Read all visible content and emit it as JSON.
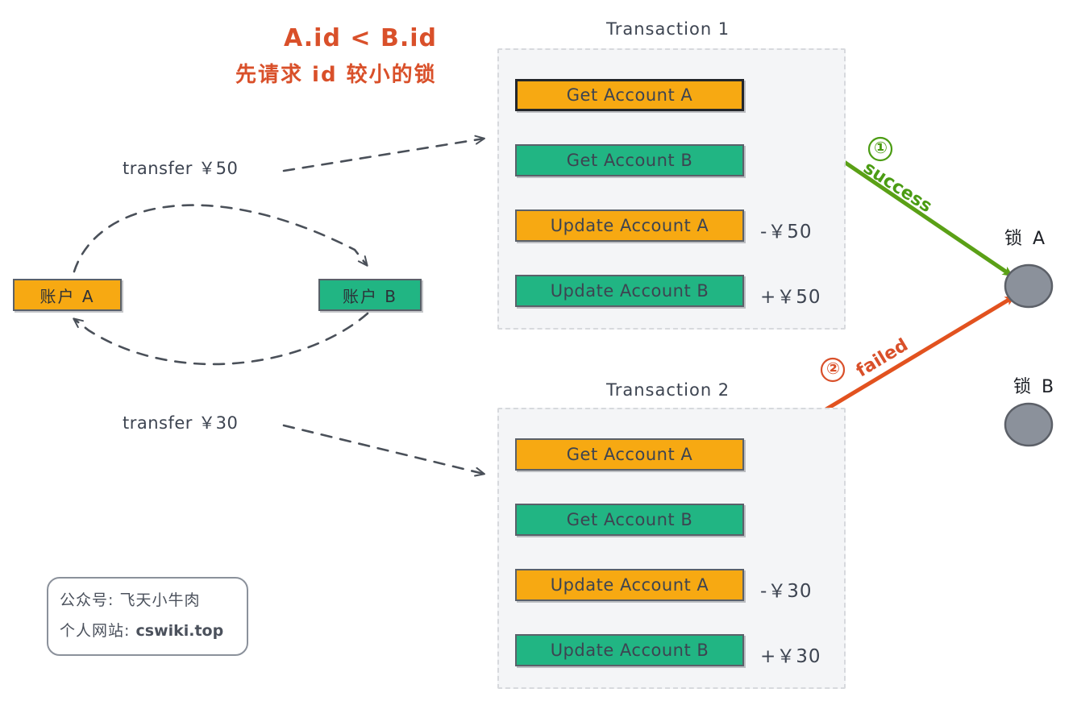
{
  "headline": {
    "line1": "A.id < B.id",
    "line2": "先请求 id 较小的锁",
    "color": "#d9502a"
  },
  "accounts": [
    {
      "label": "账户 A",
      "color": "#f7a912"
    },
    {
      "label": "账户 B",
      "color": "#21b583"
    }
  ],
  "transfers": [
    {
      "label": "transfer ￥50"
    },
    {
      "label": "transfer ￥30"
    }
  ],
  "transactions": [
    {
      "title": "Transaction 1",
      "steps": [
        {
          "label": "Get Account A",
          "color": "#f7a912",
          "amount": "",
          "highlighted": true
        },
        {
          "label": "Get Account B",
          "color": "#21b583",
          "amount": "",
          "highlighted": false
        },
        {
          "label": "Update Account A",
          "color": "#f7a912",
          "amount": "-￥50",
          "highlighted": false
        },
        {
          "label": "Update Account B",
          "color": "#21b583",
          "amount": "+￥50",
          "highlighted": false
        }
      ]
    },
    {
      "title": "Transaction 2",
      "steps": [
        {
          "label": "Get Account A",
          "color": "#f7a912",
          "amount": "",
          "highlighted": false
        },
        {
          "label": "Get Account B",
          "color": "#21b583",
          "amount": "",
          "highlighted": false
        },
        {
          "label": "Update Account A",
          "color": "#f7a912",
          "amount": "-￥30",
          "highlighted": false
        },
        {
          "label": "Update Account B",
          "color": "#21b583",
          "amount": "+￥30",
          "highlighted": false
        }
      ]
    }
  ],
  "lock_arrows": [
    {
      "marker": "①",
      "text": "success",
      "color": "#4b9c13"
    },
    {
      "marker": "②",
      "text": "failed",
      "color": "#d9502a"
    }
  ],
  "locks": [
    {
      "label": "锁 A",
      "fill": "#8b919b"
    },
    {
      "label": "锁 B",
      "fill": "#8b919b"
    }
  ],
  "watermark": {
    "line1": "公众号: 飞天小牛肉",
    "line2_prefix": "个人网站: ",
    "line2_site": "cswiki.top"
  }
}
